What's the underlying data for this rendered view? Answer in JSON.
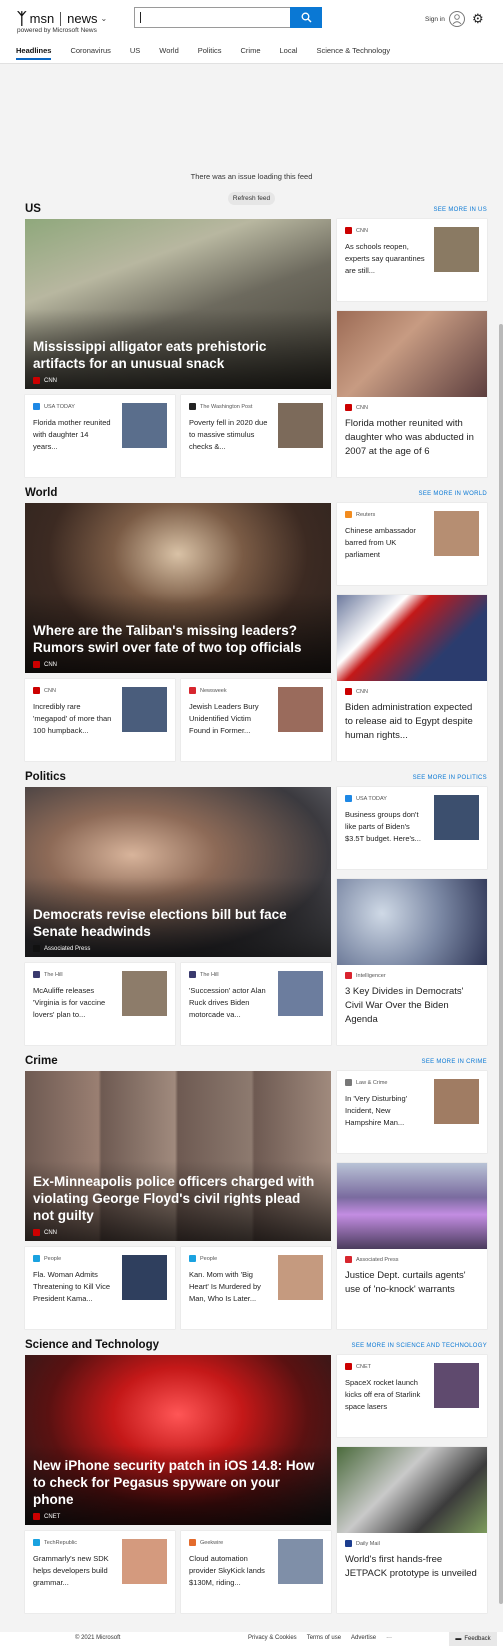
{
  "header": {
    "logo": "msn",
    "product": "news",
    "powered_by": "powered by Microsoft News",
    "search": {
      "value": "",
      "placeholder": ""
    },
    "sign_in": "Sign in",
    "nav": [
      "Headlines",
      "Coronavirus",
      "US",
      "World",
      "Politics",
      "Crime",
      "Local",
      "Science & Technology"
    ]
  },
  "feed_error": {
    "message": "There was an issue loading this feed",
    "button": "Refresh feed"
  },
  "sections": [
    {
      "title": "US",
      "more": "SEE MORE IN US",
      "hero": {
        "title": "Mississippi alligator eats prehistoric artifacts for an unusual snack",
        "source": "CNN",
        "source_color": "#cc0000"
      },
      "side": {
        "source": "CNN",
        "source_color": "#cc0000",
        "title": "As schools reopen, experts say quarantines are still..."
      },
      "small": [
        {
          "source": "USA TODAY",
          "source_color": "#1e88e5",
          "title": "Florida mother reunited with daughter 14 years..."
        },
        {
          "source": "The Washington Post",
          "source_color": "#222222",
          "title": "Poverty fell in 2020 due to massive stimulus checks &..."
        }
      ],
      "tall": {
        "source": "CNN",
        "source_color": "#cc0000",
        "title": "Florida mother reunited with daughter who was abducted in 2007 at the age of 6"
      }
    },
    {
      "title": "World",
      "more": "SEE MORE IN WORLD",
      "hero": {
        "title": "Where are the Taliban's missing leaders? Rumors swirl over fate of two top officials",
        "source": "CNN",
        "source_color": "#cc0000"
      },
      "side": {
        "source": "Reuters",
        "source_color": "#f28c1f",
        "title": "Chinese ambassador barred from UK parliament"
      },
      "small": [
        {
          "source": "CNN",
          "source_color": "#cc0000",
          "title": "Incredibly rare 'megapod' of more than 100 humpback..."
        },
        {
          "source": "Newsweek",
          "source_color": "#d7262e",
          "title": "Jewish Leaders Bury Unidentified Victim Found in Former..."
        }
      ],
      "tall": {
        "source": "CNN",
        "source_color": "#cc0000",
        "title": "Biden administration expected to release aid to Egypt despite human rights..."
      }
    },
    {
      "title": "Politics",
      "more": "SEE MORE IN POLITICS",
      "hero": {
        "title": "Democrats revise elections bill but face Senate headwinds",
        "source": "Associated Press",
        "source_color": "#111111"
      },
      "side": {
        "source": "USA TODAY",
        "source_color": "#1e88e5",
        "title": "Business groups don't like parts of Biden's $3.5T budget. Here's..."
      },
      "small": [
        {
          "source": "The Hill",
          "source_color": "#3a3a6e",
          "title": "McAuliffe releases 'Virginia is for vaccine lovers' plan to..."
        },
        {
          "source": "The Hill",
          "source_color": "#3a3a6e",
          "title": "'Succession' actor Alan Ruck drives Biden motorcade va..."
        }
      ],
      "tall": {
        "source": "Intelligencer",
        "source_color": "#d9232e",
        "title": "3 Key Divides in Democrats' Civil War Over the Biden Agenda"
      }
    },
    {
      "title": "Crime",
      "more": "SEE MORE IN CRIME",
      "hero": {
        "title": "Ex-Minneapolis police officers charged with violating George Floyd's civil rights plead not guilty",
        "source": "CNN",
        "source_color": "#cc0000"
      },
      "side": {
        "source": "Law & Crime",
        "source_color": "#777777",
        "title": "In 'Very Disturbing' Incident, New Hampshire Man..."
      },
      "small": [
        {
          "source": "People",
          "source_color": "#1aa2e0",
          "title": "Fla. Woman Admits Threatening to Kill Vice President Kama..."
        },
        {
          "source": "People",
          "source_color": "#1aa2e0",
          "title": "Kan. Mom with 'Big Heart' Is Murdered by Man, Who Is Later..."
        }
      ],
      "tall": {
        "source": "Associated Press",
        "source_color": "#d7262e",
        "title": "Justice Dept. curtails agents' use of 'no-knock' warrants"
      }
    },
    {
      "title": "Science and Technology",
      "more": "SEE MORE IN SCIENCE AND TECHNOLOGY",
      "hero": {
        "title": "New iPhone security patch in iOS 14.8: How to check for Pegasus spyware on your phone",
        "source": "CNET",
        "source_color": "#cc0000"
      },
      "side": {
        "source": "CNET",
        "source_color": "#cc0000",
        "title": "SpaceX rocket launch kicks off era of Starlink space lasers"
      },
      "small": [
        {
          "source": "TechRepublic",
          "source_color": "#1aa2e0",
          "title": "Grammarly's new SDK helps developers build grammar..."
        },
        {
          "source": "Geekwire",
          "source_color": "#e36b2c",
          "title": "Cloud automation provider SkyKick lands $130M, riding..."
        }
      ],
      "tall": {
        "source": "Daily Mail",
        "source_color": "#1c3d8f",
        "title": "World's first hands-free JETPACK prototype is unveiled"
      }
    }
  ],
  "footer": {
    "copyright": "© 2021 Microsoft",
    "links": [
      "Privacy & Cookies",
      "Terms of use",
      "Advertise"
    ],
    "more": "···",
    "feedback": "Feedback"
  }
}
